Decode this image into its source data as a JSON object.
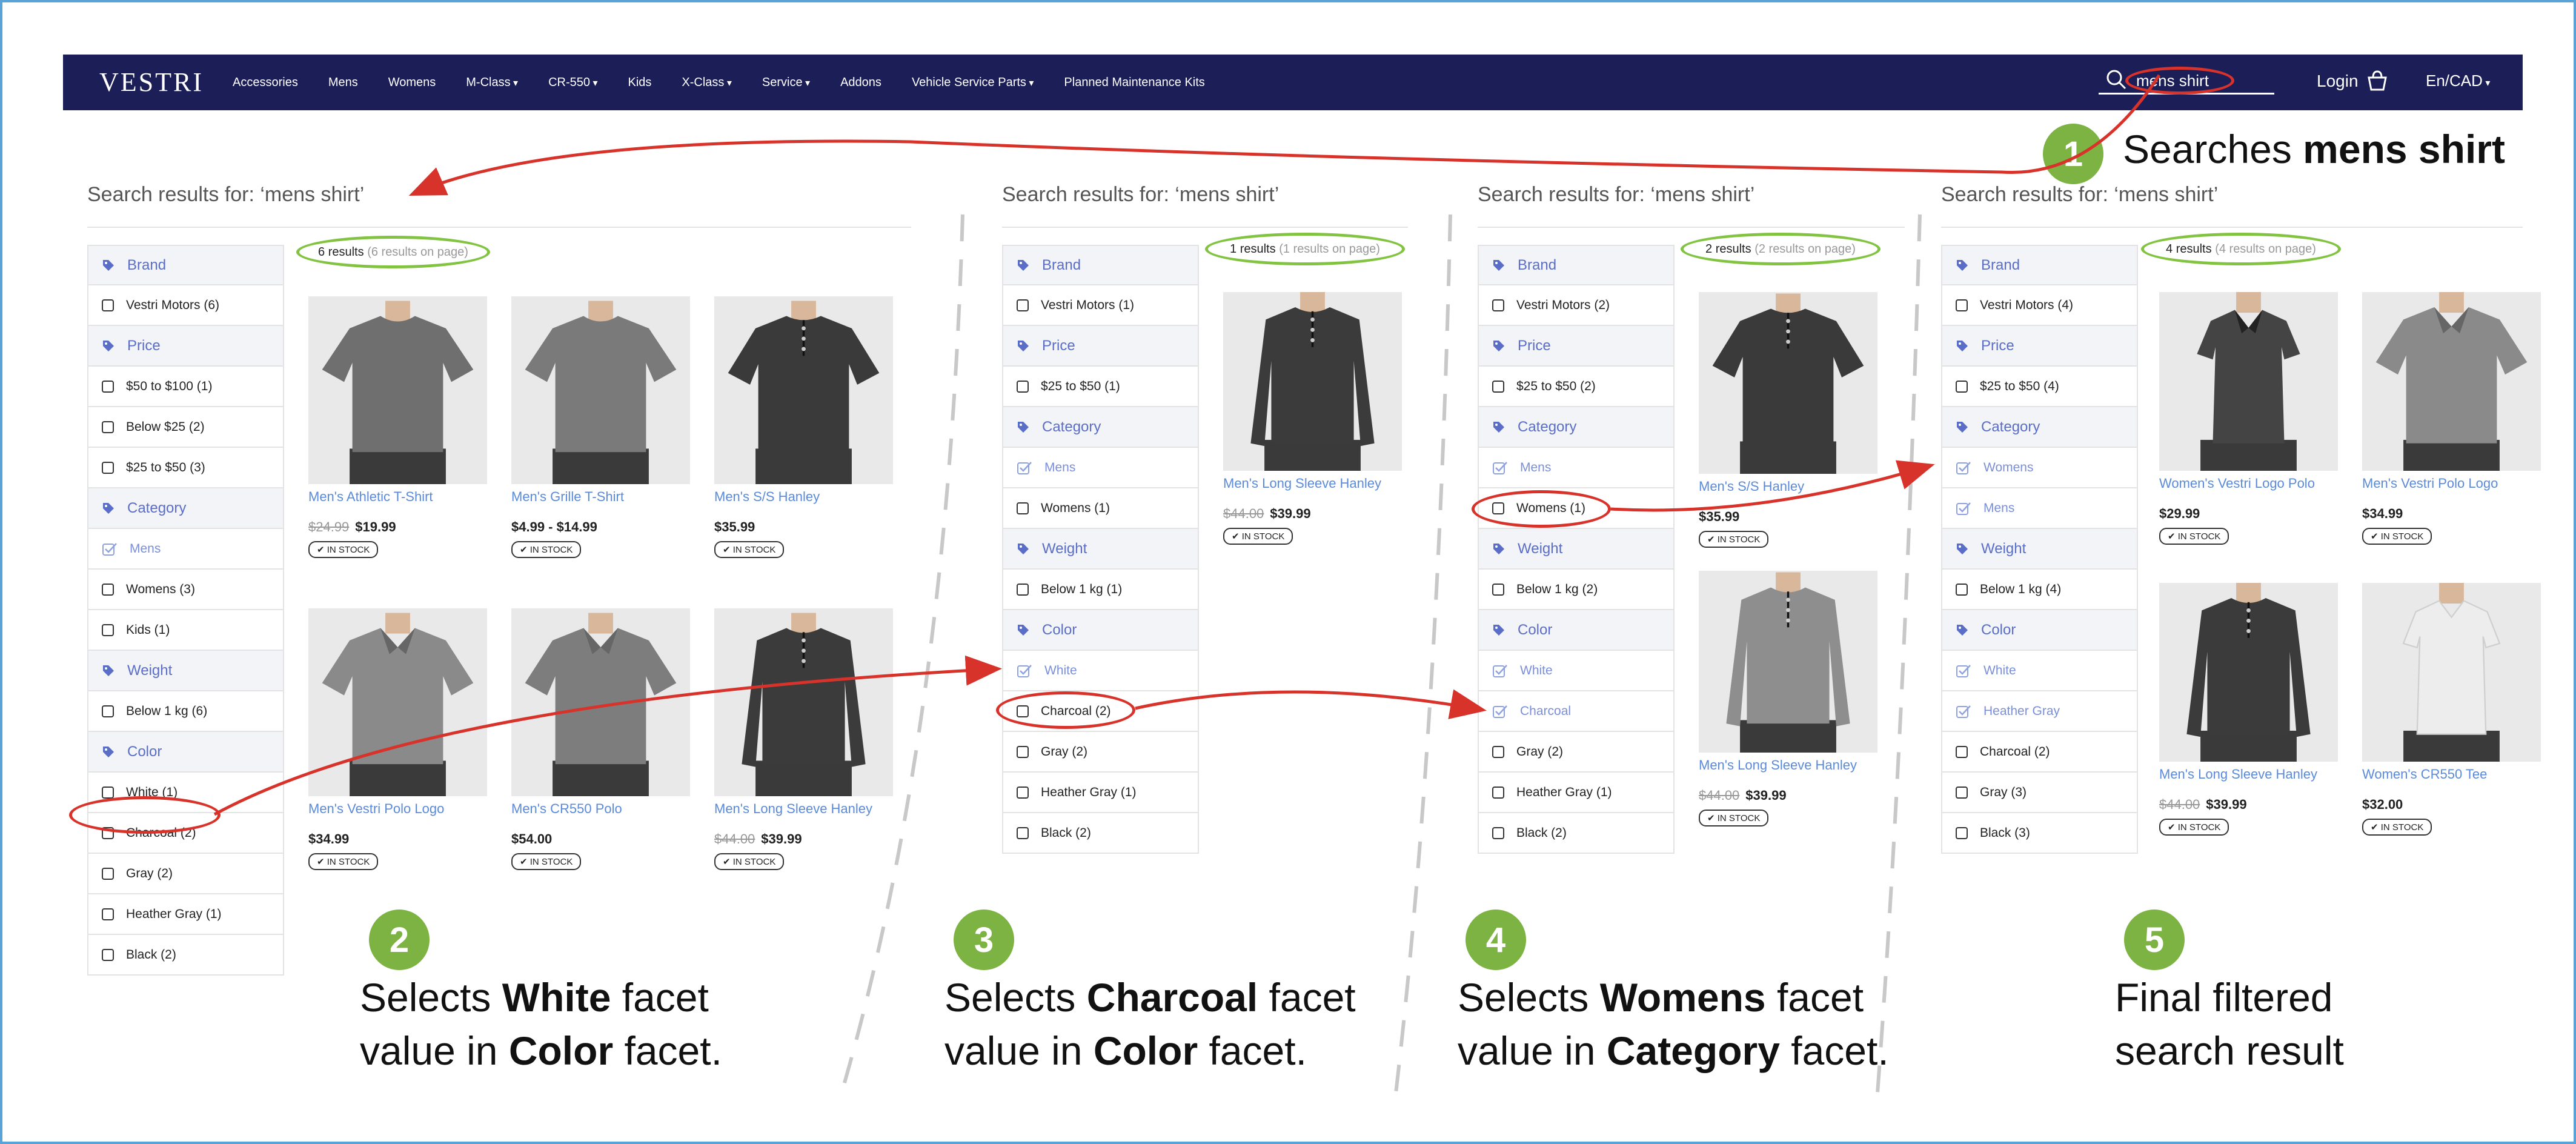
{
  "header": {
    "logo": "VESTRI",
    "nav": [
      "Accessories",
      "Mens",
      "Womens",
      "M-Class",
      "CR-550",
      "Kids",
      "X-Class",
      "Service",
      "Addons",
      "Vehicle Service Parts",
      "Planned Maintenance Kits"
    ],
    "nav_caret": [
      false,
      false,
      false,
      true,
      true,
      false,
      true,
      true,
      false,
      true,
      false
    ],
    "search_value": "mens shirt",
    "login": "Login",
    "lang": "En/CAD"
  },
  "columns": [
    {
      "heading": "Search results for: ‘mens shirt’",
      "count": "6 results",
      "count_page": "(6 results on page)",
      "facets": [
        {
          "kind": "head",
          "label": "Brand"
        },
        {
          "kind": "opt",
          "label": "Vestri Motors (6)"
        },
        {
          "kind": "head",
          "label": "Price"
        },
        {
          "kind": "opt",
          "label": "$50 to $100 (1)"
        },
        {
          "kind": "opt",
          "label": "Below $25 (2)"
        },
        {
          "kind": "opt",
          "label": "$25 to $50 (3)"
        },
        {
          "kind": "head",
          "label": "Category"
        },
        {
          "kind": "applied",
          "label": "Mens"
        },
        {
          "kind": "opt",
          "label": "Womens (3)"
        },
        {
          "kind": "opt",
          "label": "Kids (1)"
        },
        {
          "kind": "head",
          "label": "Weight"
        },
        {
          "kind": "opt",
          "label": "Below 1 kg (6)"
        },
        {
          "kind": "head",
          "label": "Color"
        },
        {
          "kind": "opt",
          "label": "White (1)"
        },
        {
          "kind": "opt",
          "label": "Charcoal (2)"
        },
        {
          "kind": "opt",
          "label": "Gray (2)"
        },
        {
          "kind": "opt",
          "label": "Heather Gray (1)"
        },
        {
          "kind": "opt",
          "label": "Black (2)"
        }
      ],
      "products": [
        {
          "name": "Men's Athletic T-Shirt",
          "old": "$24.99",
          "price": "$19.99",
          "stock": "IN STOCK",
          "shirt": "tee",
          "color": "#6f6f6f"
        },
        {
          "name": "Men's Grille T-Shirt",
          "old": "",
          "price": "$4.99 - $14.99",
          "stock": "IN STOCK",
          "shirt": "tee",
          "color": "#7a7a7a"
        },
        {
          "name": "Men's S/S Hanley",
          "old": "",
          "price": "$35.99",
          "stock": "IN STOCK",
          "shirt": "henley",
          "color": "#3a3a3a"
        },
        {
          "name": "Men's Vestri Polo Logo",
          "old": "",
          "price": "$34.99",
          "stock": "IN STOCK",
          "shirt": "polo",
          "color": "#8a8a8a"
        },
        {
          "name": "Men's CR550 Polo",
          "old": "",
          "price": "$54.00",
          "stock": "IN STOCK",
          "shirt": "polo",
          "color": "#7d7d7d"
        },
        {
          "name": "Men's Long Sleeve Hanley",
          "old": "$44.00",
          "price": "$39.99",
          "stock": "IN STOCK",
          "shirt": "longsleeve",
          "color": "#3b3b3b"
        }
      ]
    },
    {
      "heading": "Search results for: ‘mens shirt’",
      "count": "1 results",
      "count_page": "(1 results on page)",
      "facets": [
        {
          "kind": "head",
          "label": "Brand"
        },
        {
          "kind": "opt",
          "label": "Vestri Motors (1)"
        },
        {
          "kind": "head",
          "label": "Price"
        },
        {
          "kind": "opt",
          "label": "$25 to $50 (1)"
        },
        {
          "kind": "head",
          "label": "Category"
        },
        {
          "kind": "applied",
          "label": "Mens"
        },
        {
          "kind": "opt",
          "label": "Womens (1)"
        },
        {
          "kind": "head",
          "label": "Weight"
        },
        {
          "kind": "opt",
          "label": "Below 1 kg (1)"
        },
        {
          "kind": "head",
          "label": "Color"
        },
        {
          "kind": "applied",
          "label": "White"
        },
        {
          "kind": "opt",
          "label": "Charcoal (2)"
        },
        {
          "kind": "opt",
          "label": "Gray (2)"
        },
        {
          "kind": "opt",
          "label": "Heather Gray (1)"
        },
        {
          "kind": "opt",
          "label": "Black (2)"
        }
      ],
      "products": [
        {
          "name": "Men's Long Sleeve Hanley",
          "old": "$44.00",
          "price": "$39.99",
          "stock": "IN STOCK",
          "shirt": "longsleeve",
          "color": "#3b3b3b"
        }
      ]
    },
    {
      "heading": "Search results for: ‘mens shirt’",
      "count": "2 results",
      "count_page": "(2 results on page)",
      "facets": [
        {
          "kind": "head",
          "label": "Brand"
        },
        {
          "kind": "opt",
          "label": "Vestri Motors (2)"
        },
        {
          "kind": "head",
          "label": "Price"
        },
        {
          "kind": "opt",
          "label": "$25 to $50 (2)"
        },
        {
          "kind": "head",
          "label": "Category"
        },
        {
          "kind": "applied",
          "label": "Mens"
        },
        {
          "kind": "opt",
          "label": "Womens (1)"
        },
        {
          "kind": "head",
          "label": "Weight"
        },
        {
          "kind": "opt",
          "label": "Below 1 kg (2)"
        },
        {
          "kind": "head",
          "label": "Color"
        },
        {
          "kind": "applied",
          "label": "White"
        },
        {
          "kind": "applied",
          "label": "Charcoal"
        },
        {
          "kind": "opt",
          "label": "Gray (2)"
        },
        {
          "kind": "opt",
          "label": "Heather Gray (1)"
        },
        {
          "kind": "opt",
          "label": "Black (2)"
        }
      ],
      "products": [
        {
          "name": "Men's S/S Hanley",
          "old": "",
          "price": "$35.99",
          "stock": "IN STOCK",
          "shirt": "henley",
          "color": "#3a3a3a"
        },
        {
          "name": "Men's Long Sleeve Hanley",
          "old": "$44.00",
          "price": "$39.99",
          "stock": "IN STOCK",
          "shirt": "longsleeve",
          "color": "#8e8e8e"
        }
      ]
    },
    {
      "heading": "Search results for: ‘mens shirt’",
      "count": "4 results",
      "count_page": "(4 results on page)",
      "facets": [
        {
          "kind": "head",
          "label": "Brand"
        },
        {
          "kind": "opt",
          "label": "Vestri Motors (4)"
        },
        {
          "kind": "head",
          "label": "Price"
        },
        {
          "kind": "opt",
          "label": "$25 to $50 (4)"
        },
        {
          "kind": "head",
          "label": "Category"
        },
        {
          "kind": "applied",
          "label": "Womens"
        },
        {
          "kind": "applied",
          "label": "Mens"
        },
        {
          "kind": "head",
          "label": "Weight"
        },
        {
          "kind": "opt",
          "label": "Below 1 kg (4)"
        },
        {
          "kind": "head",
          "label": "Color"
        },
        {
          "kind": "applied",
          "label": "White"
        },
        {
          "kind": "applied",
          "label": "Heather Gray"
        },
        {
          "kind": "opt",
          "label": "Charcoal (2)"
        },
        {
          "kind": "opt",
          "label": "Gray (3)"
        },
        {
          "kind": "opt",
          "label": "Black (3)"
        }
      ],
      "products": [
        {
          "name": "Women's Vestri Logo Polo",
          "old": "",
          "price": "$29.99",
          "stock": "IN STOCK",
          "shirt": "womenpolo",
          "color": "#444444"
        },
        {
          "name": "Men's Vestri Polo Logo",
          "old": "",
          "price": "$34.99",
          "stock": "IN STOCK",
          "shirt": "polo",
          "color": "#8a8a8a"
        },
        {
          "name": "Men's Long Sleeve Hanley",
          "old": "$44.00",
          "price": "$39.99",
          "stock": "IN STOCK",
          "shirt": "longsleeve",
          "color": "#3b3b3b"
        },
        {
          "name": "Women's CR550 Tee",
          "old": "",
          "price": "$32.00",
          "stock": "IN STOCK",
          "shirt": "womentee",
          "color": "#ededed"
        }
      ]
    }
  ],
  "steps": [
    {
      "num": "1",
      "lines": [
        [
          "Searches ",
          ""
        ],
        [
          "mens shirt",
          "b"
        ]
      ]
    },
    {
      "num": "2",
      "line1": [
        [
          "Selects ",
          ""
        ],
        [
          "White",
          "b"
        ],
        [
          " facet",
          ""
        ]
      ],
      "line2": [
        [
          "value in ",
          ""
        ],
        [
          "Color",
          "b"
        ],
        [
          " facet.",
          ""
        ]
      ]
    },
    {
      "num": "3",
      "line1": [
        [
          "Selects ",
          ""
        ],
        [
          "Charcoal",
          "b"
        ],
        [
          " facet",
          ""
        ]
      ],
      "line2": [
        [
          "value in ",
          ""
        ],
        [
          "Color",
          "b"
        ],
        [
          " facet.",
          ""
        ]
      ]
    },
    {
      "num": "4",
      "line1": [
        [
          "Selects ",
          ""
        ],
        [
          "Womens",
          "b"
        ],
        [
          " facet",
          ""
        ]
      ],
      "line2": [
        [
          "value in ",
          ""
        ],
        [
          "Category",
          "b"
        ],
        [
          " facet.",
          ""
        ]
      ]
    },
    {
      "num": "5",
      "line1": [
        [
          "Final filtered",
          ""
        ]
      ],
      "line2": [
        [
          "search result",
          ""
        ]
      ]
    }
  ],
  "colors": {
    "navbar": "#1b1e57",
    "accent": "#5b6ec7",
    "step_green": "#7cb342",
    "annotation_red": "#d8332b",
    "count_ring": "#82c341"
  }
}
